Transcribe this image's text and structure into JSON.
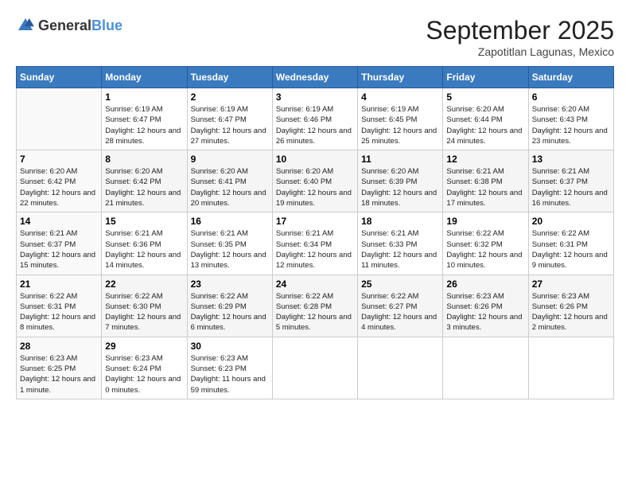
{
  "header": {
    "logo_general": "General",
    "logo_blue": "Blue",
    "month": "September 2025",
    "location": "Zapotitlan Lagunas, Mexico"
  },
  "days_of_week": [
    "Sunday",
    "Monday",
    "Tuesday",
    "Wednesday",
    "Thursday",
    "Friday",
    "Saturday"
  ],
  "weeks": [
    [
      {
        "day": "",
        "sunrise": "",
        "sunset": "",
        "daylight": ""
      },
      {
        "day": "1",
        "sunrise": "Sunrise: 6:19 AM",
        "sunset": "Sunset: 6:47 PM",
        "daylight": "Daylight: 12 hours and 28 minutes."
      },
      {
        "day": "2",
        "sunrise": "Sunrise: 6:19 AM",
        "sunset": "Sunset: 6:47 PM",
        "daylight": "Daylight: 12 hours and 27 minutes."
      },
      {
        "day": "3",
        "sunrise": "Sunrise: 6:19 AM",
        "sunset": "Sunset: 6:46 PM",
        "daylight": "Daylight: 12 hours and 26 minutes."
      },
      {
        "day": "4",
        "sunrise": "Sunrise: 6:19 AM",
        "sunset": "Sunset: 6:45 PM",
        "daylight": "Daylight: 12 hours and 25 minutes."
      },
      {
        "day": "5",
        "sunrise": "Sunrise: 6:20 AM",
        "sunset": "Sunset: 6:44 PM",
        "daylight": "Daylight: 12 hours and 24 minutes."
      },
      {
        "day": "6",
        "sunrise": "Sunrise: 6:20 AM",
        "sunset": "Sunset: 6:43 PM",
        "daylight": "Daylight: 12 hours and 23 minutes."
      }
    ],
    [
      {
        "day": "7",
        "sunrise": "Sunrise: 6:20 AM",
        "sunset": "Sunset: 6:42 PM",
        "daylight": "Daylight: 12 hours and 22 minutes."
      },
      {
        "day": "8",
        "sunrise": "Sunrise: 6:20 AM",
        "sunset": "Sunset: 6:42 PM",
        "daylight": "Daylight: 12 hours and 21 minutes."
      },
      {
        "day": "9",
        "sunrise": "Sunrise: 6:20 AM",
        "sunset": "Sunset: 6:41 PM",
        "daylight": "Daylight: 12 hours and 20 minutes."
      },
      {
        "day": "10",
        "sunrise": "Sunrise: 6:20 AM",
        "sunset": "Sunset: 6:40 PM",
        "daylight": "Daylight: 12 hours and 19 minutes."
      },
      {
        "day": "11",
        "sunrise": "Sunrise: 6:20 AM",
        "sunset": "Sunset: 6:39 PM",
        "daylight": "Daylight: 12 hours and 18 minutes."
      },
      {
        "day": "12",
        "sunrise": "Sunrise: 6:21 AM",
        "sunset": "Sunset: 6:38 PM",
        "daylight": "Daylight: 12 hours and 17 minutes."
      },
      {
        "day": "13",
        "sunrise": "Sunrise: 6:21 AM",
        "sunset": "Sunset: 6:37 PM",
        "daylight": "Daylight: 12 hours and 16 minutes."
      }
    ],
    [
      {
        "day": "14",
        "sunrise": "Sunrise: 6:21 AM",
        "sunset": "Sunset: 6:37 PM",
        "daylight": "Daylight: 12 hours and 15 minutes."
      },
      {
        "day": "15",
        "sunrise": "Sunrise: 6:21 AM",
        "sunset": "Sunset: 6:36 PM",
        "daylight": "Daylight: 12 hours and 14 minutes."
      },
      {
        "day": "16",
        "sunrise": "Sunrise: 6:21 AM",
        "sunset": "Sunset: 6:35 PM",
        "daylight": "Daylight: 12 hours and 13 minutes."
      },
      {
        "day": "17",
        "sunrise": "Sunrise: 6:21 AM",
        "sunset": "Sunset: 6:34 PM",
        "daylight": "Daylight: 12 hours and 12 minutes."
      },
      {
        "day": "18",
        "sunrise": "Sunrise: 6:21 AM",
        "sunset": "Sunset: 6:33 PM",
        "daylight": "Daylight: 12 hours and 11 minutes."
      },
      {
        "day": "19",
        "sunrise": "Sunrise: 6:22 AM",
        "sunset": "Sunset: 6:32 PM",
        "daylight": "Daylight: 12 hours and 10 minutes."
      },
      {
        "day": "20",
        "sunrise": "Sunrise: 6:22 AM",
        "sunset": "Sunset: 6:31 PM",
        "daylight": "Daylight: 12 hours and 9 minutes."
      }
    ],
    [
      {
        "day": "21",
        "sunrise": "Sunrise: 6:22 AM",
        "sunset": "Sunset: 6:31 PM",
        "daylight": "Daylight: 12 hours and 8 minutes."
      },
      {
        "day": "22",
        "sunrise": "Sunrise: 6:22 AM",
        "sunset": "Sunset: 6:30 PM",
        "daylight": "Daylight: 12 hours and 7 minutes."
      },
      {
        "day": "23",
        "sunrise": "Sunrise: 6:22 AM",
        "sunset": "Sunset: 6:29 PM",
        "daylight": "Daylight: 12 hours and 6 minutes."
      },
      {
        "day": "24",
        "sunrise": "Sunrise: 6:22 AM",
        "sunset": "Sunset: 6:28 PM",
        "daylight": "Daylight: 12 hours and 5 minutes."
      },
      {
        "day": "25",
        "sunrise": "Sunrise: 6:22 AM",
        "sunset": "Sunset: 6:27 PM",
        "daylight": "Daylight: 12 hours and 4 minutes."
      },
      {
        "day": "26",
        "sunrise": "Sunrise: 6:23 AM",
        "sunset": "Sunset: 6:26 PM",
        "daylight": "Daylight: 12 hours and 3 minutes."
      },
      {
        "day": "27",
        "sunrise": "Sunrise: 6:23 AM",
        "sunset": "Sunset: 6:26 PM",
        "daylight": "Daylight: 12 hours and 2 minutes."
      }
    ],
    [
      {
        "day": "28",
        "sunrise": "Sunrise: 6:23 AM",
        "sunset": "Sunset: 6:25 PM",
        "daylight": "Daylight: 12 hours and 1 minute."
      },
      {
        "day": "29",
        "sunrise": "Sunrise: 6:23 AM",
        "sunset": "Sunset: 6:24 PM",
        "daylight": "Daylight: 12 hours and 0 minutes."
      },
      {
        "day": "30",
        "sunrise": "Sunrise: 6:23 AM",
        "sunset": "Sunset: 6:23 PM",
        "daylight": "Daylight: 11 hours and 59 minutes."
      },
      {
        "day": "",
        "sunrise": "",
        "sunset": "",
        "daylight": ""
      },
      {
        "day": "",
        "sunrise": "",
        "sunset": "",
        "daylight": ""
      },
      {
        "day": "",
        "sunrise": "",
        "sunset": "",
        "daylight": ""
      },
      {
        "day": "",
        "sunrise": "",
        "sunset": "",
        "daylight": ""
      }
    ]
  ]
}
